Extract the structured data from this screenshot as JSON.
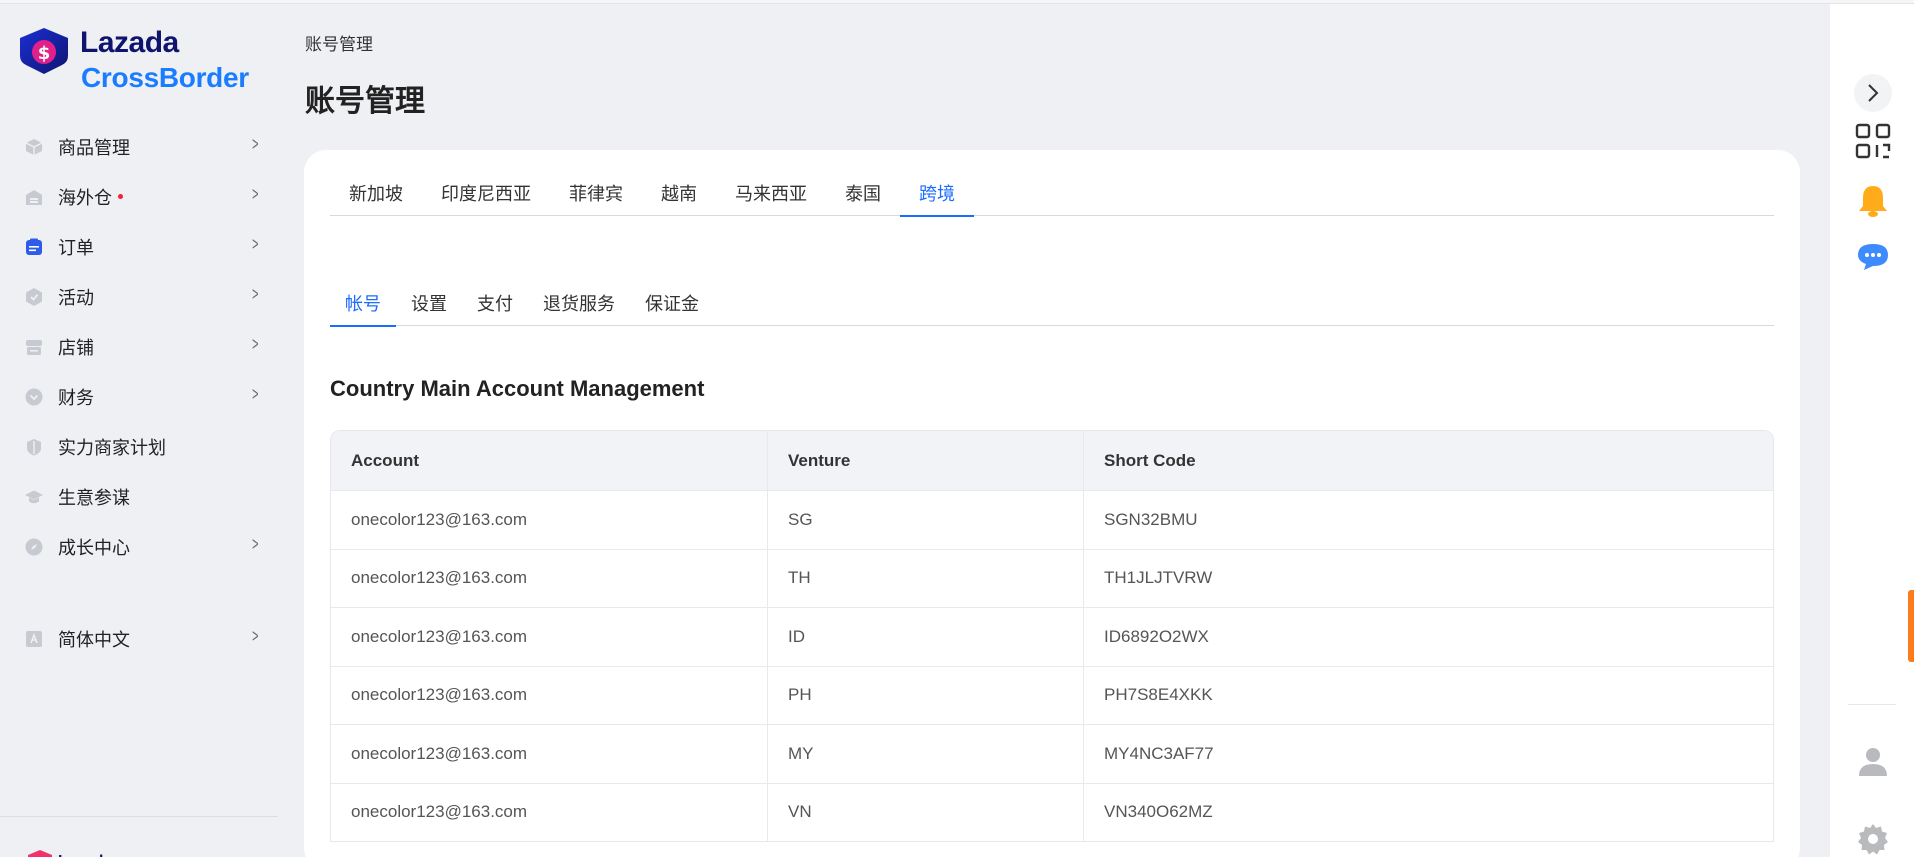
{
  "brand": {
    "name_line1": "Lazada",
    "name_line2": "CrossBorder",
    "accent": "#1a6dff",
    "navy": "#0f146d"
  },
  "sidebar": {
    "items": [
      {
        "label": "商品管理",
        "icon": "box-icon",
        "has_chevron": true,
        "dot": false
      },
      {
        "label": "海外仓",
        "icon": "warehouse-icon",
        "has_chevron": true,
        "dot": true
      },
      {
        "label": "订单",
        "icon": "order-icon",
        "has_chevron": true,
        "dot": false
      },
      {
        "label": "活动",
        "icon": "activity-icon",
        "has_chevron": true,
        "dot": false
      },
      {
        "label": "店铺",
        "icon": "store-icon",
        "has_chevron": true,
        "dot": false
      },
      {
        "label": "财务",
        "icon": "finance-icon",
        "has_chevron": true,
        "dot": false
      },
      {
        "label": "实力商家计划",
        "icon": "shield-icon",
        "has_chevron": false,
        "dot": false
      },
      {
        "label": "生意参谋",
        "icon": "graduation-icon",
        "has_chevron": false,
        "dot": false
      },
      {
        "label": "成长中心",
        "icon": "compass-icon",
        "has_chevron": true,
        "dot": false
      }
    ],
    "language": {
      "label": "简体中文",
      "icon": "language-icon"
    }
  },
  "header": {
    "breadcrumb": "账号管理",
    "title": "账号管理"
  },
  "main": {
    "tabs": [
      "新加坡",
      "印度尼西亚",
      "菲律宾",
      "越南",
      "马来西亚",
      "泰国",
      "跨境"
    ],
    "active_tab": 6,
    "subtabs": [
      "帐号",
      "设置",
      "支付",
      "退货服务",
      "保证金"
    ],
    "active_subtab": 0,
    "section_title": "Country Main Account Management",
    "table": {
      "columns": [
        "Account",
        "Venture",
        "Short Code"
      ],
      "rows": [
        [
          "onecolor123@163.com",
          "SG",
          "SGN32BMU"
        ],
        [
          "onecolor123@163.com",
          "TH",
          "TH1JLJTVRW"
        ],
        [
          "onecolor123@163.com",
          "ID",
          "ID6892O2WX"
        ],
        [
          "onecolor123@163.com",
          "PH",
          "PH7S8E4XKK"
        ],
        [
          "onecolor123@163.com",
          "MY",
          "MY4NC3AF77"
        ],
        [
          "onecolor123@163.com",
          "VN",
          "VN340O62MZ"
        ]
      ]
    }
  },
  "rail": {
    "buttons": [
      "collapse-arrow-icon",
      "qr-code-icon",
      "bell-icon",
      "chat-icon",
      "user-icon",
      "settings-icon"
    ]
  }
}
